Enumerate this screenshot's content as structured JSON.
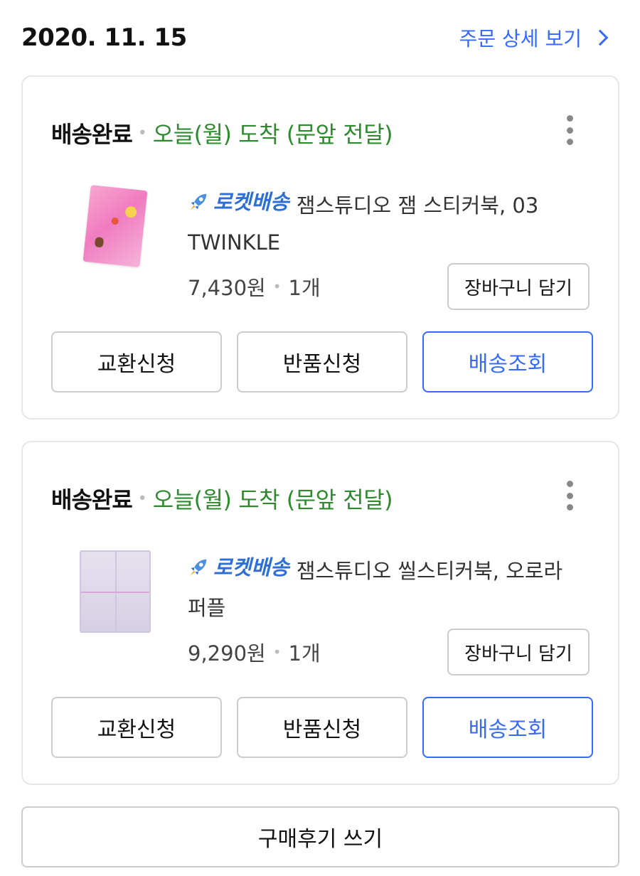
{
  "order": {
    "date": "2020. 11. 15",
    "detail_link": "주문 상세 보기"
  },
  "items": [
    {
      "status": "배송완료",
      "arrival": "오늘(월) 도착 (문앞 전달)",
      "rocket_label": "로켓배송",
      "product_name": "잼스튜디오 잼 스티커북, 03 TWINKLE",
      "price": "7,430원",
      "quantity": "1개",
      "cart_button": "장바구니 담기",
      "actions": [
        "교환신청",
        "반품신청",
        "배송조회"
      ]
    },
    {
      "status": "배송완료",
      "arrival": "오늘(월) 도착 (문앞 전달)",
      "rocket_label": "로켓배송",
      "product_name": "잼스튜디오 씰스티커북, 오로라 퍼플",
      "price": "9,290원",
      "quantity": "1개",
      "cart_button": "장바구니 담기",
      "actions": [
        "교환신청",
        "반품신청",
        "배송조회"
      ]
    }
  ],
  "review_button": "구매후기 쓰기",
  "colors": {
    "accent": "#346aff",
    "arrival_green": "#2d8b2d",
    "rocket_blue": "#2d6fd6"
  },
  "icons": {
    "more": "more-vertical-icon",
    "chevron": "chevron-right-icon",
    "rocket": "rocket-icon"
  }
}
